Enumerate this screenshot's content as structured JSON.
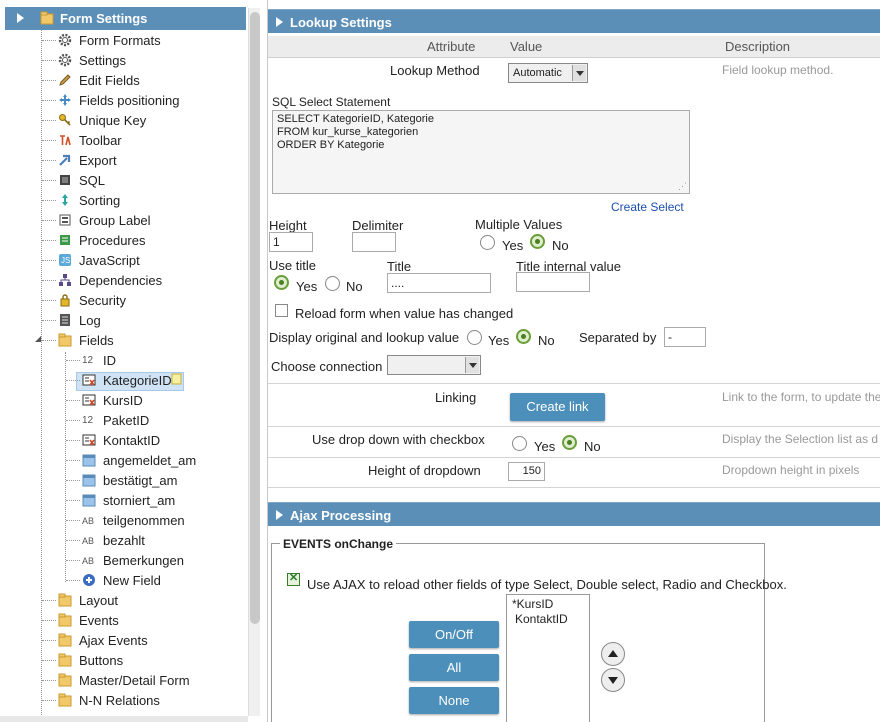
{
  "tree": {
    "root": "Form Settings",
    "items": [
      {
        "label": "Form Formats",
        "icon": "gear-icon"
      },
      {
        "label": "Settings",
        "icon": "gear-icon"
      },
      {
        "label": "Edit Fields",
        "icon": "pencil-icon"
      },
      {
        "label": "Fields positioning",
        "icon": "move-icon"
      },
      {
        "label": "Unique Key",
        "icon": "key-icon"
      },
      {
        "label": "Toolbar",
        "icon": "toolbar-icon"
      },
      {
        "label": "Export",
        "icon": "export-icon"
      },
      {
        "label": "SQL",
        "icon": "sql-icon"
      },
      {
        "label": "Sorting",
        "icon": "sorting-icon"
      },
      {
        "label": "Group Label",
        "icon": "group-label-icon"
      },
      {
        "label": "Procedures",
        "icon": "procedures-icon"
      },
      {
        "label": "JavaScript",
        "icon": "javascript-icon"
      },
      {
        "label": "Dependencies",
        "icon": "dependencies-icon"
      },
      {
        "label": "Security",
        "icon": "lock-icon"
      },
      {
        "label": "Log",
        "icon": "log-icon"
      },
      {
        "label": "Fields",
        "icon": "folder-icon"
      }
    ],
    "fields": [
      {
        "label": "ID",
        "type": "12"
      },
      {
        "label": "KategorieID",
        "type": "select"
      },
      {
        "label": "KursID",
        "type": "select"
      },
      {
        "label": "PaketID",
        "type": "12"
      },
      {
        "label": "KontaktID",
        "type": "select"
      },
      {
        "label": "angemeldet_am",
        "type": "date"
      },
      {
        "label": "bestätigt_am",
        "type": "date"
      },
      {
        "label": "storniert_am",
        "type": "date"
      },
      {
        "label": "teilgenommen",
        "type": "AB"
      },
      {
        "label": "bezahlt",
        "type": "AB"
      },
      {
        "label": "Bemerkungen",
        "type": "AB"
      },
      {
        "label": "New Field",
        "type": "new"
      }
    ],
    "folders": [
      "Layout",
      "Events",
      "Ajax Events",
      "Buttons",
      "Master/Detail Form",
      "N-N Relations"
    ]
  },
  "lookup": {
    "title": "Lookup Settings",
    "col_attribute": "Attribute",
    "col_value": "Value",
    "col_description": "Description",
    "lookup_method_label": "Lookup Method",
    "lookup_method_value": "Automatic",
    "lookup_method_desc": "Field lookup method.",
    "sql_label": "SQL Select Statement",
    "sql_line1": "SELECT KategorieID, Kategorie",
    "sql_line2": "FROM kur_kurse_kategorien",
    "sql_line3": "ORDER BY Kategorie",
    "create_select": "Create Select",
    "height_label": "Height",
    "height_value": "1",
    "delimiter_label": "Delimiter",
    "multiple_values_label": "Multiple Values",
    "yes": "Yes",
    "no": "No",
    "use_title_label": "Use title",
    "title_label": "Title",
    "title_value": "....",
    "title_internal_label": "Title internal value",
    "reload_label": "Reload form when value has changed",
    "display_orig_label": "Display original and lookup value",
    "separated_by_label": "Separated by",
    "separated_by_value": "-",
    "choose_connection_label": "Choose connection",
    "linking_label": "Linking",
    "create_link": "Create link",
    "linking_desc": "Link to the form, to update the",
    "dropdown_checkbox_label": "Use drop down with checkbox",
    "dropdown_checkbox_desc": "Display the Selection list as d",
    "height_dropdown_label": "Height of dropdown",
    "height_dropdown_value": "150",
    "height_dropdown_desc": "Dropdown height in pixels"
  },
  "ajax": {
    "title": "Ajax Processing",
    "events_label": "EVENTS onChange",
    "use_ajax_label": "Use AJAX to reload other fields of type Select, Double select, Radio and Checkbox.",
    "btn_onoff": "On/Off",
    "btn_all": "All",
    "btn_none": "None",
    "list_items": [
      "*KursID",
      "KontaktID"
    ]
  },
  "colors": {
    "header": "#5b8fb8",
    "button": "#4b8fba",
    "radio_on": "#6a9e3a"
  }
}
